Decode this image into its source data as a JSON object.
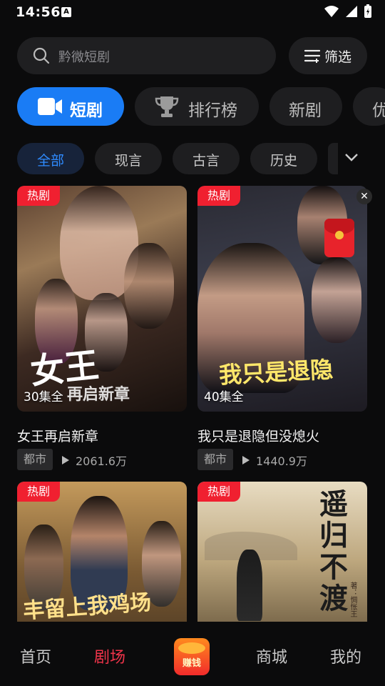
{
  "status": {
    "time": "14:56",
    "badge": "A"
  },
  "search": {
    "placeholder": "黔微短剧"
  },
  "filter": {
    "label": "筛选"
  },
  "categories": [
    {
      "label": "短剧",
      "active": true
    },
    {
      "label": "排行榜"
    },
    {
      "label": "新剧"
    },
    {
      "label": "优"
    }
  ],
  "chips": [
    {
      "label": "全部",
      "active": true
    },
    {
      "label": "现言"
    },
    {
      "label": "古言"
    },
    {
      "label": "历史"
    }
  ],
  "cards": [
    {
      "badge": "热剧",
      "episodes": "30集全",
      "title": "女王再启新章",
      "tag": "都市",
      "plays": "2061.6万",
      "poster_text": "女王",
      "poster_sub": "再启新章"
    },
    {
      "badge": "热剧",
      "episodes": "40集全",
      "title": "我只是退隐但没熄火",
      "tag": "都市",
      "plays": "1440.9万",
      "poster_text": "我只是退隐"
    },
    {
      "badge": "热剧",
      "poster_text": "丰留上我鸡场"
    },
    {
      "badge": "热剧",
      "poster_text": "遥归不渡",
      "poster_small": "著：惆怅王"
    }
  ],
  "nav": {
    "home": "首页",
    "theater": "剧场",
    "earn": "赚钱",
    "mall": "商城",
    "mine": "我的"
  },
  "colors": {
    "accent_blue": "#1a7cf5",
    "hot_red": "#f02030",
    "nav_active": "#f0344a"
  }
}
